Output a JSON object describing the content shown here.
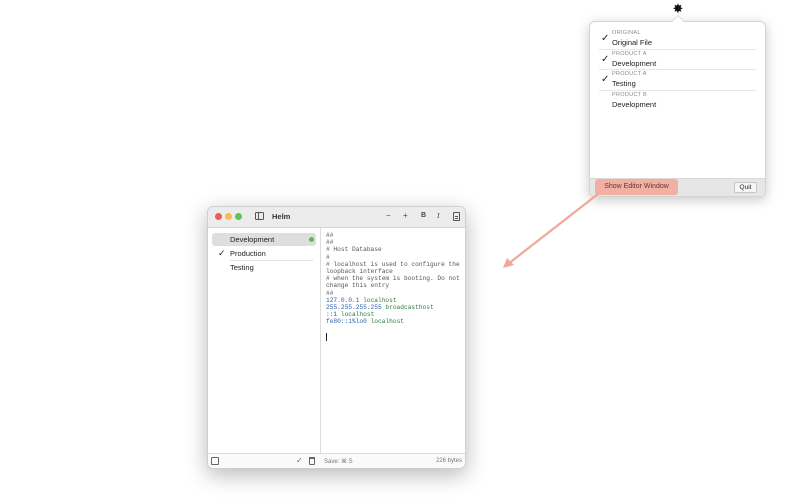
{
  "menubar": {
    "icon": "gear-icon"
  },
  "popover": {
    "profiles": [
      {
        "kicker": "ORIGINAL",
        "name": "Original File",
        "checked": true
      },
      {
        "kicker": "PRODUCT A",
        "name": "Development",
        "checked": true
      },
      {
        "kicker": "PRODUCT A",
        "name": "Testing",
        "checked": true
      },
      {
        "kicker": "PRODUCT B",
        "name": "Development",
        "checked": false
      }
    ],
    "check_glyph": "✓",
    "show_editor_label": "Show Editor Window",
    "quit_label": "Quit",
    "highlight_color": "#f2b0a2"
  },
  "window": {
    "title": "Helm",
    "toolbar": {
      "minus": "−",
      "plus": "+",
      "bold": "B",
      "italic": "I"
    },
    "sidebar": {
      "items": [
        {
          "label": "Development",
          "selected": true,
          "checked": false,
          "active_dot": true
        },
        {
          "label": "Production",
          "selected": false,
          "checked": true,
          "active_dot": false
        },
        {
          "label": "Testing",
          "selected": false,
          "checked": false,
          "active_dot": false
        }
      ]
    },
    "editor": {
      "lines": [
        {
          "text": "##",
          "kind": "comment"
        },
        {
          "text": "##",
          "kind": "comment"
        },
        {
          "text": "# Host Database",
          "kind": "comment"
        },
        {
          "text": "#",
          "kind": "comment"
        },
        {
          "text": "# localhost is used to configure the loopback interface",
          "kind": "comment"
        },
        {
          "text": "# when the system is booting. Do not change this entry",
          "kind": "comment"
        },
        {
          "text": "##",
          "kind": "comment"
        },
        {
          "ip": "127.0.0.1",
          "host": "localhost",
          "kind": "entry"
        },
        {
          "ip": "255.255.255.255",
          "host": "broadcasthost",
          "kind": "entry"
        },
        {
          "ip": "::1",
          "host": "localhost",
          "kind": "entry"
        },
        {
          "ip": "fe80::1%lo0",
          "host": "localhost",
          "kind": "entry"
        }
      ]
    },
    "statusbar": {
      "save_hint": "Save: ⌘ S",
      "size": "226 bytes",
      "check_glyph": "✓"
    }
  },
  "colors": {
    "accent_highlight": "#f2b0a2",
    "arrow": "#f0a898",
    "active_dot": "#5cb85c",
    "ip_text": "#2e5fa8",
    "host_text": "#2b7a3d"
  }
}
